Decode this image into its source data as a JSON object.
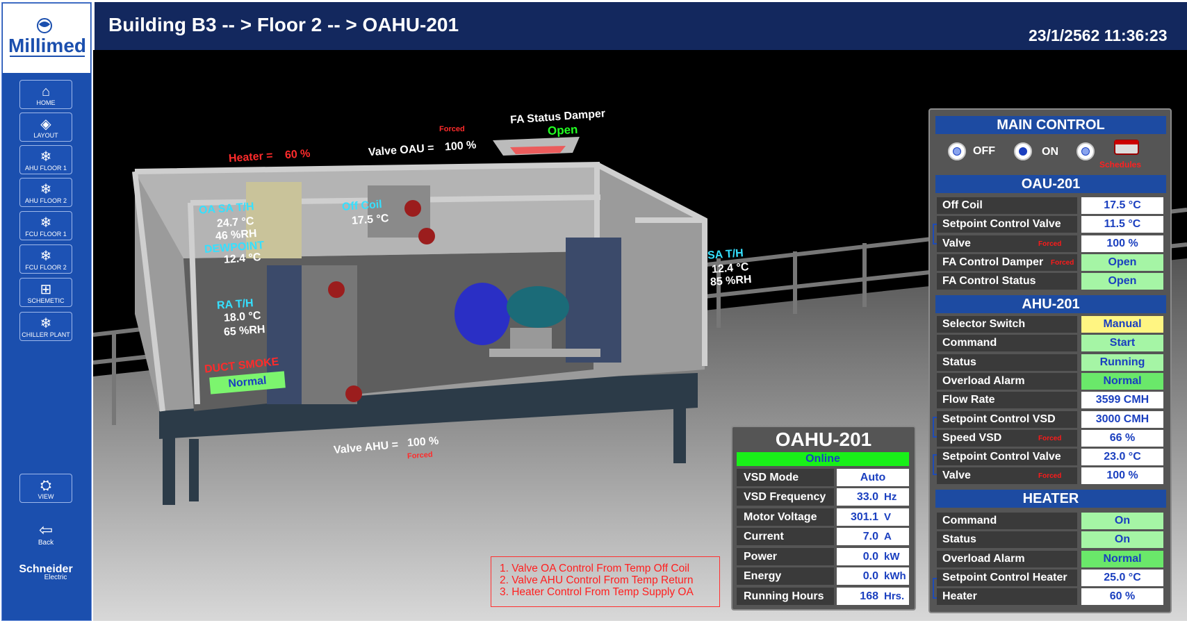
{
  "brand": {
    "logo_text": "Millimed",
    "vendor_line1": "Schneider",
    "vendor_line2": "Electric"
  },
  "nav": [
    {
      "label": "HOME",
      "icon": "home-icon",
      "glyph": "⌂"
    },
    {
      "label": "LAYOUT",
      "icon": "layers-icon",
      "glyph": "◈"
    },
    {
      "label": "AHU FLOOR 1",
      "icon": "fan-icon",
      "glyph": "❄"
    },
    {
      "label": "AHU FLOOR 2",
      "icon": "fan-icon",
      "glyph": "❄"
    },
    {
      "label": "FCU FLOOR 1",
      "icon": "fan-icon",
      "glyph": "❄"
    },
    {
      "label": "FCU FLOOR 2",
      "icon": "fan-icon",
      "glyph": "❄"
    },
    {
      "label": "SCHEMETIC",
      "icon": "schematic-icon",
      "glyph": "⊞"
    },
    {
      "label": "CHILLER PLANT",
      "icon": "fan-icon",
      "glyph": "❄"
    }
  ],
  "view_button": {
    "label": "VIEW",
    "glyph": "⛭"
  },
  "back_button": {
    "label": "Back",
    "glyph": "⇦"
  },
  "header": {
    "title": "Building B3 -- > Floor 2 -- > OAHU-201",
    "datetime": "23/1/2562 11:36:23"
  },
  "scene": {
    "fa_damper_title": "FA Status Damper",
    "fa_damper_status": "Open",
    "valve_oau_label": "Valve OAU =",
    "valve_oau_value": "100 %",
    "valve_oau_forced": "Forced",
    "heater_label": "Heater =",
    "heater_value": "60 %",
    "oa_sa_title": "OA SA T/H",
    "oa_sa_temp": "24.7 °C",
    "oa_sa_rh": "46 %RH",
    "dewpoint_title": "DEWPOINT",
    "dewpoint_value": "12.4 °C",
    "off_coil_title": "Off Coil",
    "off_coil_value": "17.5 °C",
    "sa_title": "SA T/H",
    "sa_temp": "12.4 °C",
    "sa_rh": "85 %RH",
    "ra_title": "RA T/H",
    "ra_temp": "18.0 °C",
    "ra_rh": "65 %RH",
    "duct_smoke_title": "DUCT SMOKE",
    "duct_smoke_status": "Normal",
    "valve_ahu_label": "Valve AHU =",
    "valve_ahu_value": "100 %",
    "valve_ahu_forced": "Forced"
  },
  "main_control": {
    "title": "MAIN CONTROL",
    "options": [
      "OFF",
      "ON",
      "Schedules"
    ],
    "selected": "ON"
  },
  "oau": {
    "title": "OAU-201",
    "rows": [
      {
        "label": "Off Coil",
        "value": "17.5 °C",
        "forced": ""
      },
      {
        "label": "Setpoint Control Valve",
        "value": "11.5 °C",
        "forced": ""
      },
      {
        "label": "Valve",
        "value": "100 %",
        "forced": "Forced"
      },
      {
        "label": "FA Control Damper",
        "value": "Open",
        "forced": "Forced"
      },
      {
        "label": "FA Control Status",
        "value": "Open",
        "forced": ""
      }
    ]
  },
  "ahu": {
    "title": "AHU-201",
    "rows": [
      {
        "label": "Selector Switch",
        "value": "Manual",
        "forced": ""
      },
      {
        "label": "Command",
        "value": "Start",
        "forced": ""
      },
      {
        "label": "Status",
        "value": "Running",
        "forced": ""
      },
      {
        "label": "Overload Alarm",
        "value": "Normal",
        "forced": ""
      },
      {
        "label": "Flow Rate",
        "value": "3599 CMH",
        "forced": ""
      },
      {
        "label": "Setpoint Control VSD",
        "value": "3000 CMH",
        "forced": ""
      },
      {
        "label": "Speed VSD",
        "value": "66 %",
        "forced": "Forced"
      },
      {
        "label": "Setpoint Control Valve",
        "value": "23.0 °C",
        "forced": ""
      },
      {
        "label": "Valve",
        "value": "100 %",
        "forced": "Forced"
      }
    ]
  },
  "heater": {
    "title": "HEATER",
    "rows": [
      {
        "label": "Command",
        "value": "On"
      },
      {
        "label": "Status",
        "value": "On"
      },
      {
        "label": "Overload Alarm",
        "value": "Normal"
      },
      {
        "label": "Setpoint Control Heater",
        "value": "25.0 °C"
      },
      {
        "label": "Heater",
        "value": "60 %"
      }
    ]
  },
  "oahu": {
    "title": "OAHU-201",
    "status": "Online",
    "vsd_mode_label": "VSD Mode",
    "vsd_mode_value": "Auto",
    "rows": [
      {
        "label": "VSD Frequency",
        "value": "33.0",
        "unit": "Hz"
      },
      {
        "label": "Motor Voltage",
        "value": "301.1",
        "unit": "V"
      },
      {
        "label": "Current",
        "value": "7.0",
        "unit": "A"
      },
      {
        "label": "Power",
        "value": "0.0",
        "unit": "kW"
      },
      {
        "label": "Energy",
        "value": "0.0",
        "unit": "kWh"
      },
      {
        "label": "Running Hours",
        "value": "168",
        "unit": "Hrs."
      }
    ]
  },
  "notes": [
    "1. Valve OA Control From Temp Off Coil",
    "2. Valve AHU Control From Temp Return",
    "3. Heater Control From Temp Supply OA"
  ]
}
